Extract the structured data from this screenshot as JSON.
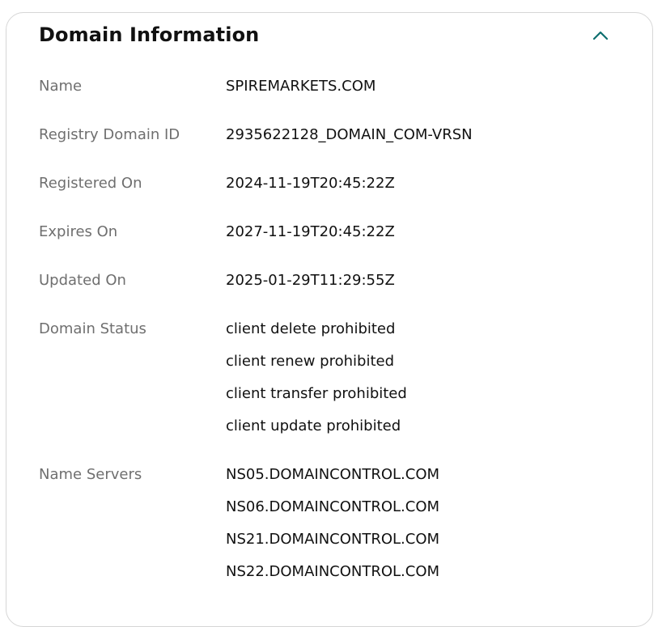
{
  "panel": {
    "title": "Domain Information",
    "collapse_icon": "chevron-up-icon",
    "accent_color": "#0d6e6e"
  },
  "fields": {
    "name": {
      "label": "Name",
      "value": "SPIREMARKETS.COM"
    },
    "registry_id": {
      "label": "Registry Domain ID",
      "value": "2935622128_DOMAIN_COM-VRSN"
    },
    "registered_on": {
      "label": "Registered On",
      "value": "2024-11-19T20:45:22Z"
    },
    "expires_on": {
      "label": "Expires On",
      "value": "2027-11-19T20:45:22Z"
    },
    "updated_on": {
      "label": "Updated On",
      "value": "2025-01-29T11:29:55Z"
    },
    "domain_status": {
      "label": "Domain Status",
      "values": [
        "client delete prohibited",
        "client renew prohibited",
        "client transfer prohibited",
        "client update prohibited"
      ]
    },
    "name_servers": {
      "label": "Name Servers",
      "values": [
        "NS05.DOMAINCONTROL.COM",
        "NS06.DOMAINCONTROL.COM",
        "NS21.DOMAINCONTROL.COM",
        "NS22.DOMAINCONTROL.COM"
      ]
    }
  }
}
